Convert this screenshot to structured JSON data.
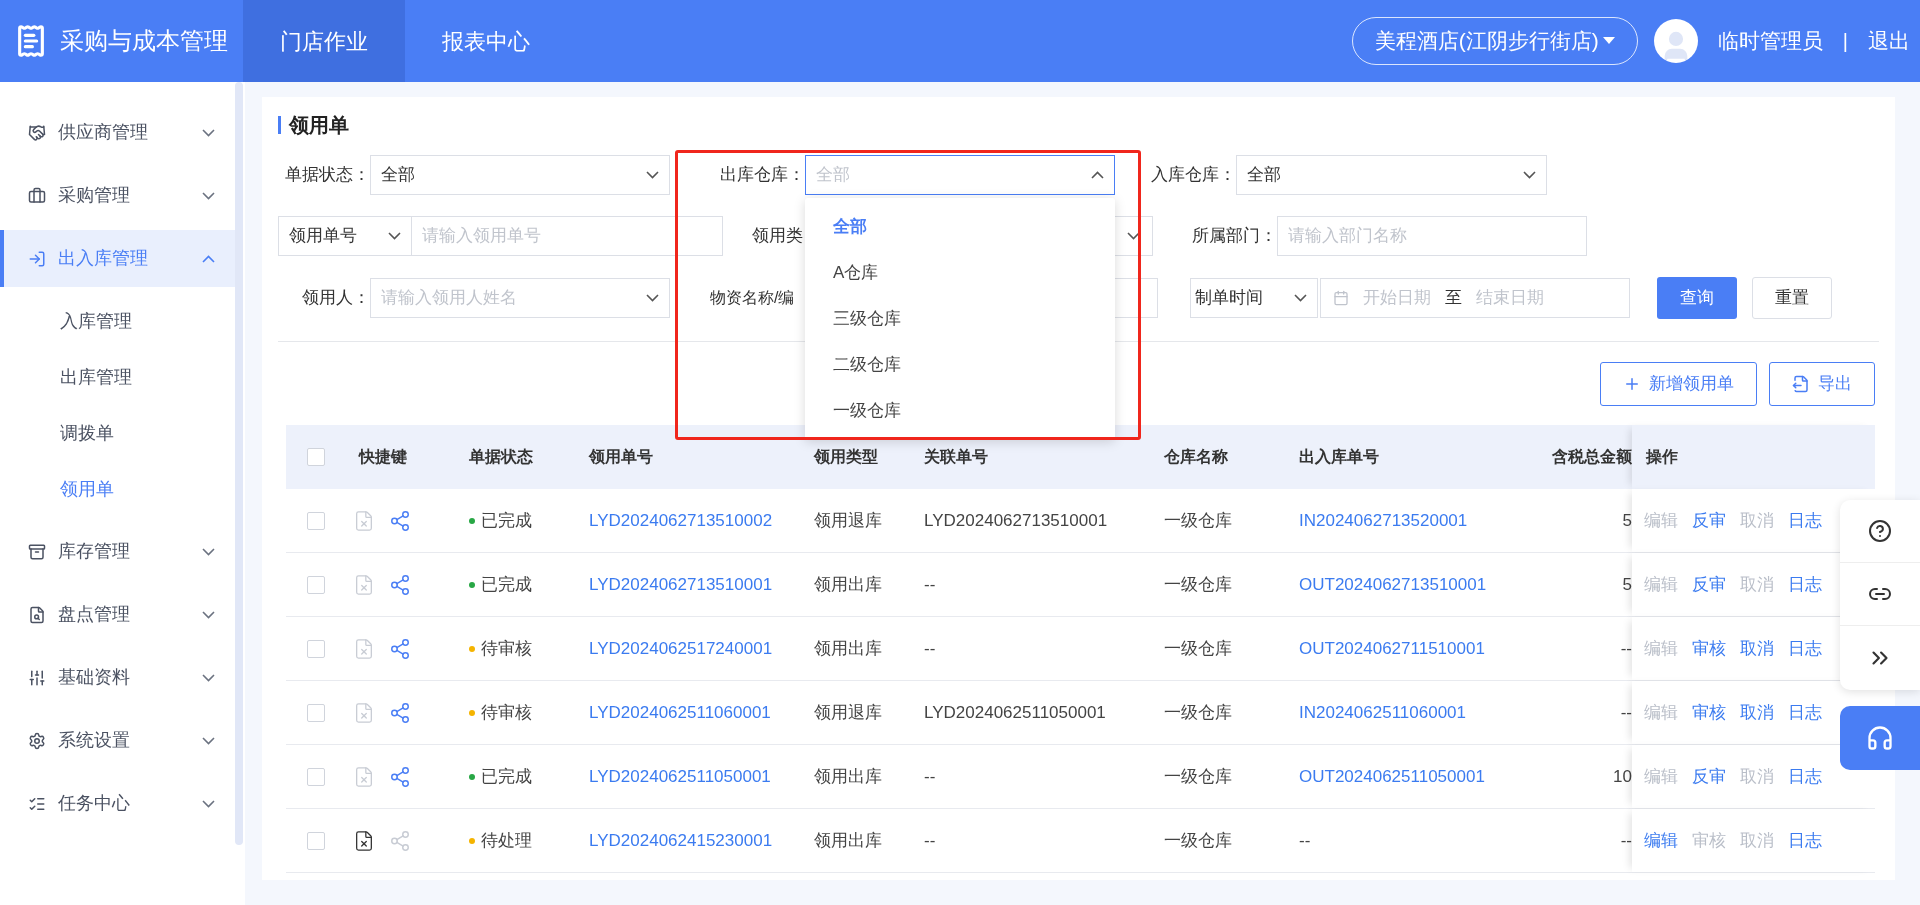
{
  "app": {
    "title": "采购与成本管理"
  },
  "top_nav": [
    {
      "label": "门店作业",
      "selected": true
    },
    {
      "label": "报表中心",
      "selected": false
    }
  ],
  "store_selector": "美程酒店(江阴步行街店)",
  "user": {
    "name": "临时管理员",
    "separator": "|",
    "logout": "退出"
  },
  "sidebar": [
    {
      "label": "供应商管理",
      "expanded": false,
      "selected": false
    },
    {
      "label": "采购管理",
      "expanded": false,
      "selected": false
    },
    {
      "label": "出入库管理",
      "expanded": true,
      "selected": true,
      "children": [
        {
          "label": "入库管理",
          "selected": false
        },
        {
          "label": "出库管理",
          "selected": false
        },
        {
          "label": "调拨单",
          "selected": false
        },
        {
          "label": "领用单",
          "selected": true
        }
      ]
    },
    {
      "label": "库存管理",
      "expanded": false,
      "selected": false
    },
    {
      "label": "盘点管理",
      "expanded": false,
      "selected": false
    },
    {
      "label": "基础资料",
      "expanded": false,
      "selected": false
    },
    {
      "label": "系统设置",
      "expanded": false,
      "selected": false
    },
    {
      "label": "任务中心",
      "expanded": false,
      "selected": false
    }
  ],
  "page_title": "领用单",
  "filters": {
    "status": {
      "label": "单据状态：",
      "value": "全部"
    },
    "out_warehouse": {
      "label": "出库仓库：",
      "placeholder": "全部",
      "open": true,
      "options": [
        {
          "label": "全部",
          "selected": true
        },
        {
          "label": "A仓库",
          "selected": false
        },
        {
          "label": "三级仓库",
          "selected": false
        },
        {
          "label": "二级仓库",
          "selected": false
        },
        {
          "label": "一级仓库",
          "selected": false
        }
      ]
    },
    "in_warehouse": {
      "label": "入库仓库：",
      "value": "全部"
    },
    "order_no": {
      "prefix": "领用单号",
      "placeholder": "请输入领用单号"
    },
    "type": {
      "label": "领用类"
    },
    "department": {
      "label": "所属部门：",
      "placeholder": "请输入部门名称"
    },
    "receiver": {
      "label": "领用人：",
      "placeholder": "请输入领用人姓名"
    },
    "material": {
      "label": "物资名称/编"
    },
    "date": {
      "prefix": "制单时间",
      "start_placeholder": "开始日期",
      "separator": "至",
      "end_placeholder": "结束日期"
    },
    "query": "查询",
    "reset": "重置"
  },
  "toolbar": {
    "add": "新增领用单",
    "export": "导出"
  },
  "table": {
    "select_all": false,
    "columns": [
      "快捷键",
      "单据状态",
      "领用单号",
      "领用类型",
      "关联单号",
      "仓库名称",
      "出入库单号",
      "含税总金额",
      "操作"
    ],
    "rows": [
      {
        "checked": false,
        "delete_enabled": false,
        "flow_enabled": true,
        "status": "已完成",
        "color": "#28a745",
        "order_no": "LYD2024062713510002",
        "type": "领用退库",
        "related_no": "LYD2024062713510001",
        "warehouse": "一级仓库",
        "io_no": "IN2024062713520001",
        "amount": "5",
        "actions": [
          {
            "label": "编辑",
            "enabled": false
          },
          {
            "label": "反审",
            "enabled": true
          },
          {
            "label": "取消",
            "enabled": false
          },
          {
            "label": "日志",
            "enabled": true
          }
        ]
      },
      {
        "checked": false,
        "delete_enabled": false,
        "flow_enabled": true,
        "status": "已完成",
        "color": "#28a745",
        "order_no": "LYD2024062713510001",
        "type": "领用出库",
        "related_no": "--",
        "warehouse": "一级仓库",
        "io_no": "OUT2024062713510001",
        "amount": "5",
        "actions": [
          {
            "label": "编辑",
            "enabled": false
          },
          {
            "label": "反审",
            "enabled": true
          },
          {
            "label": "取消",
            "enabled": false
          },
          {
            "label": "日志",
            "enabled": true
          }
        ]
      },
      {
        "checked": false,
        "delete_enabled": false,
        "flow_enabled": true,
        "status": "待审核",
        "color": "#f5b400",
        "order_no": "LYD2024062517240001",
        "type": "领用出库",
        "related_no": "--",
        "warehouse": "一级仓库",
        "io_no": "OUT2024062711510001",
        "amount": "--",
        "actions": [
          {
            "label": "编辑",
            "enabled": false
          },
          {
            "label": "审核",
            "enabled": true
          },
          {
            "label": "取消",
            "enabled": true
          },
          {
            "label": "日志",
            "enabled": true
          }
        ]
      },
      {
        "checked": false,
        "delete_enabled": false,
        "flow_enabled": true,
        "status": "待审核",
        "color": "#f5b400",
        "order_no": "LYD2024062511060001",
        "type": "领用退库",
        "related_no": "LYD2024062511050001",
        "warehouse": "一级仓库",
        "io_no": "IN2024062511060001",
        "amount": "--",
        "actions": [
          {
            "label": "编辑",
            "enabled": false
          },
          {
            "label": "审核",
            "enabled": true
          },
          {
            "label": "取消",
            "enabled": true
          },
          {
            "label": "日志",
            "enabled": true
          }
        ]
      },
      {
        "checked": false,
        "delete_enabled": false,
        "flow_enabled": true,
        "status": "已完成",
        "color": "#28a745",
        "order_no": "LYD2024062511050001",
        "type": "领用出库",
        "related_no": "--",
        "warehouse": "一级仓库",
        "io_no": "OUT2024062511050001",
        "amount": "10",
        "actions": [
          {
            "label": "编辑",
            "enabled": false
          },
          {
            "label": "反审",
            "enabled": true
          },
          {
            "label": "取消",
            "enabled": false
          },
          {
            "label": "日志",
            "enabled": true
          }
        ]
      },
      {
        "checked": false,
        "delete_enabled": true,
        "flow_enabled": false,
        "status": "待处理",
        "color": "#f5b400",
        "order_no": "LYD2024062415230001",
        "type": "领用出库",
        "related_no": "--",
        "warehouse": "一级仓库",
        "io_no": "--",
        "amount": "--",
        "actions": [
          {
            "label": "编辑",
            "enabled": true
          },
          {
            "label": "审核",
            "enabled": false
          },
          {
            "label": "取消",
            "enabled": false
          },
          {
            "label": "日志",
            "enabled": true
          }
        ]
      }
    ]
  }
}
